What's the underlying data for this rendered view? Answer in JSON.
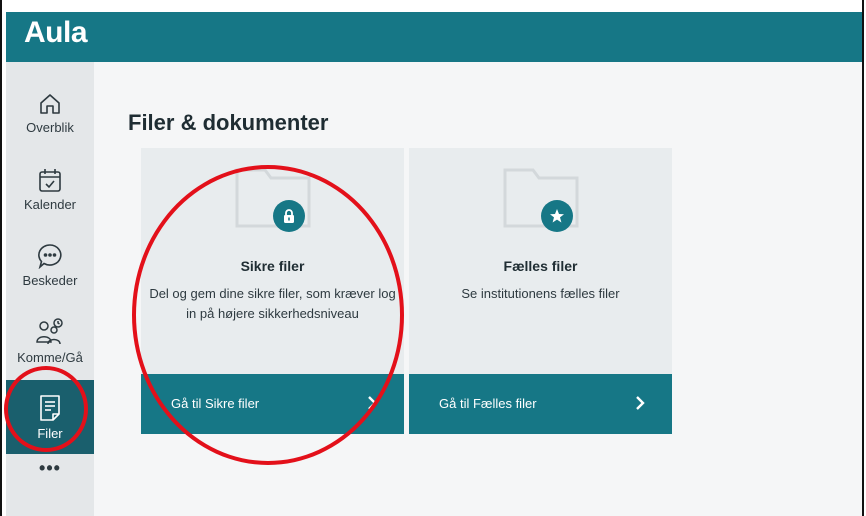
{
  "header": {
    "logo": "Aula"
  },
  "sidebar": {
    "items": [
      {
        "label": "Overblik",
        "icon": "home-icon"
      },
      {
        "label": "Kalender",
        "icon": "calendar-icon"
      },
      {
        "label": "Beskeder",
        "icon": "chat-icon"
      },
      {
        "label": "Komme/Gå",
        "icon": "people-clock-icon"
      },
      {
        "label": "Filer",
        "icon": "document-icon",
        "active": true
      }
    ],
    "more": "•••"
  },
  "main": {
    "title": "Filer & dokumenter",
    "cards": [
      {
        "title": "Sikre filer",
        "description": "Del og gem dine sikre filer, som kræver log in på højere sikkerhedsniveau",
        "button": "Gå til Sikre filer",
        "icon": "lock-icon"
      },
      {
        "title": "Fælles filer",
        "description": "Se institutionens fælles filer",
        "button": "Gå til Fælles filer",
        "icon": "star-icon"
      }
    ]
  },
  "colors": {
    "brand": "#167786",
    "active_nav": "#1a5f6d",
    "annotation": "#e3101a"
  }
}
